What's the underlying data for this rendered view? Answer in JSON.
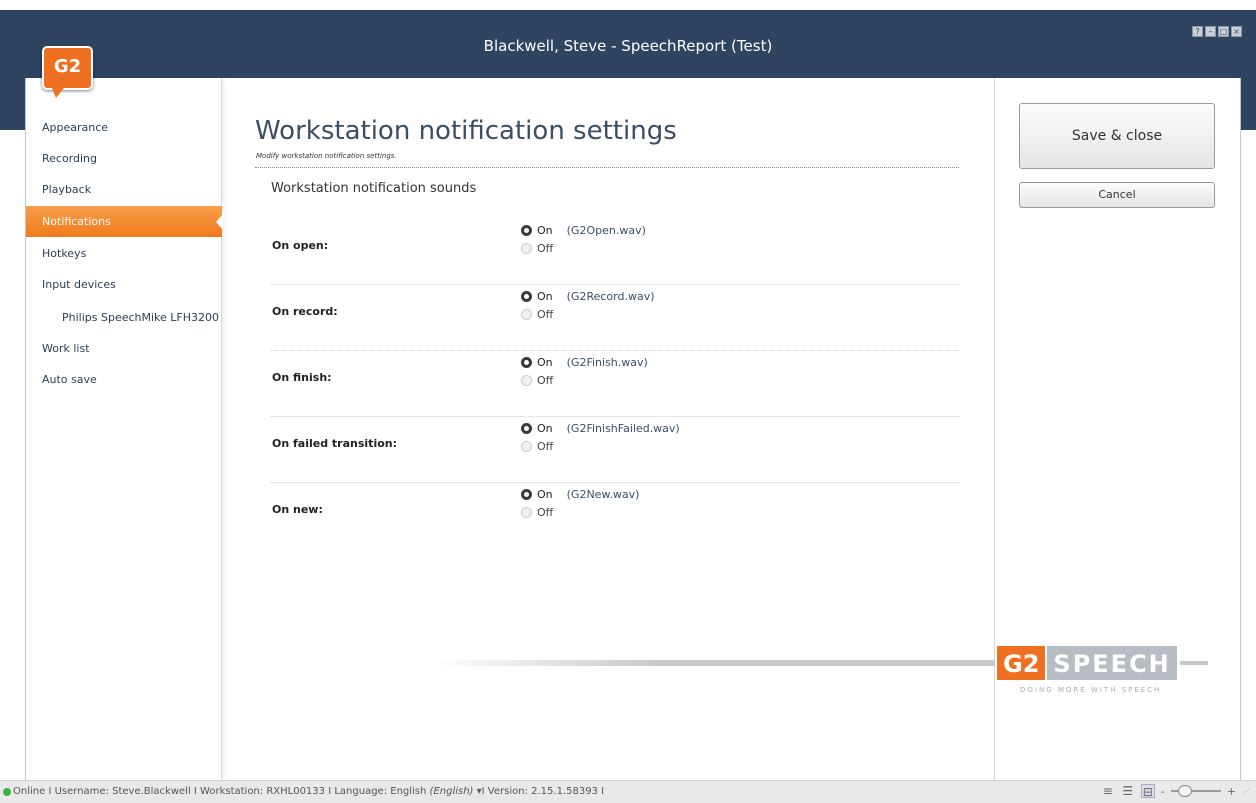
{
  "window": {
    "title": "Blackwell, Steve - SpeechReport (Test)",
    "controls": [
      "?",
      "–",
      "□",
      "×"
    ],
    "logo": "G2"
  },
  "sidebar": {
    "items": [
      {
        "label": "Appearance",
        "active": false
      },
      {
        "label": "Recording",
        "active": false
      },
      {
        "label": "Playback",
        "active": false
      },
      {
        "label": "Notifications",
        "active": true
      },
      {
        "label": "Hotkeys",
        "active": false
      },
      {
        "label": "Input devices",
        "active": false
      },
      {
        "label": "Philips SpeechMike LFH3200",
        "active": false,
        "sub": true
      },
      {
        "label": "Work list",
        "active": false
      },
      {
        "label": "Auto save",
        "active": false
      }
    ]
  },
  "main": {
    "title": "Workstation notification settings",
    "subtitle": "Modify workstation notification settings.",
    "section_title": "Workstation notification sounds",
    "rows": [
      {
        "label": "On open:",
        "on": "On",
        "off": "Off",
        "file": "(G2Open.wav)",
        "selected": "on"
      },
      {
        "label": "On record:",
        "on": "On",
        "off": "Off",
        "file": "(G2Record.wav)",
        "selected": "on"
      },
      {
        "label": "On finish:",
        "on": "On",
        "off": "Off",
        "file": "(G2Finish.wav)",
        "selected": "on"
      },
      {
        "label": "On failed transition:",
        "on": "On",
        "off": "Off",
        "file": "(G2FinishFailed.wav)",
        "selected": "on"
      },
      {
        "label": "On new:",
        "on": "On",
        "off": "Off",
        "file": "(G2New.wav)",
        "selected": "on"
      }
    ]
  },
  "actions": {
    "save_label": "Save & close",
    "cancel_label": "Cancel"
  },
  "brand": {
    "g2": "G2",
    "speech": "SPEECH",
    "tagline": "DOING MORE WITH SPEECH"
  },
  "status": {
    "online": "Online",
    "username": "I Username: Steve.Blackwell",
    "workstation": "I Workstation: RXHL00133",
    "language_prefix": "I Language:  English ",
    "language_italic": "(English)",
    "language_arrow": " ▾ ",
    "version": " I Version: 2.15.1.58393 I",
    "zoom_minus": "-",
    "zoom_plus": "+",
    "zoom_level": 0.2
  },
  "colors": {
    "titlebar": "#2f4460",
    "accent": "#f07022",
    "online": "#3ab53a"
  }
}
